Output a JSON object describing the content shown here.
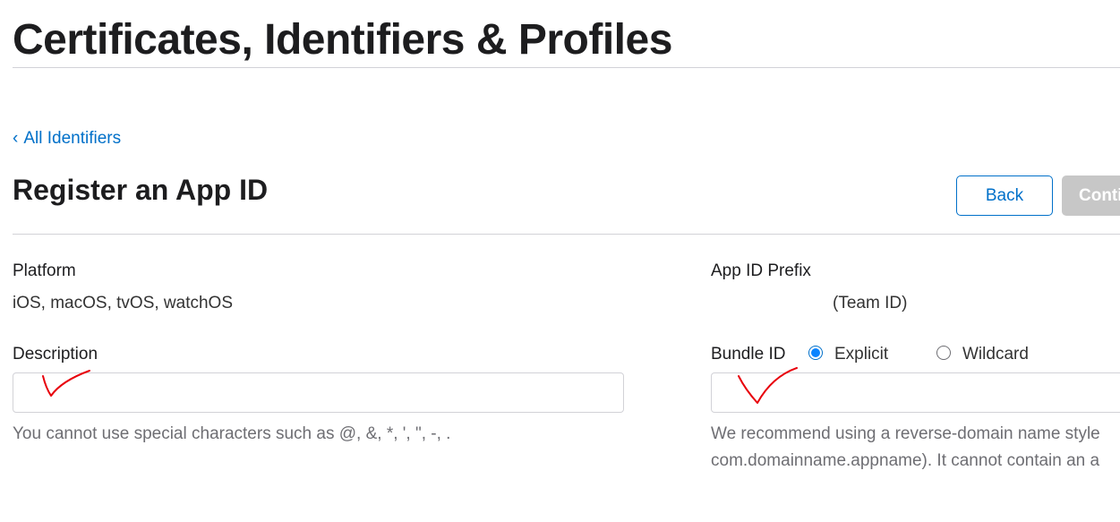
{
  "header": {
    "title": "Certificates, Identifiers & Profiles"
  },
  "nav": {
    "back_link_chevron": "‹",
    "back_link_label": "All Identifiers"
  },
  "form": {
    "title": "Register an App ID",
    "back_button": "Back",
    "continue_button": "Conti",
    "platform": {
      "label": "Platform",
      "value": "iOS, macOS, tvOS, watchOS"
    },
    "app_id_prefix": {
      "label": "App ID Prefix",
      "value": "(Team ID)"
    },
    "description": {
      "label": "Description",
      "value": "",
      "placeholder": "",
      "hint": "You cannot use special characters such as @, &, *, ', \", -, ."
    },
    "bundle_id": {
      "label": "Bundle ID",
      "options": [
        {
          "label": "Explicit",
          "selected": true
        },
        {
          "label": "Wildcard",
          "selected": false
        }
      ],
      "value": "",
      "placeholder": "",
      "hint_line1": "We recommend using a reverse-domain name style",
      "hint_line2": "com.domainname.appname). It cannot contain an a"
    }
  },
  "colors": {
    "link": "#0070c9",
    "radio_selected": "#0a84ff",
    "disabled_button": "#c7c7c7",
    "annotation_mark": "#e8000b"
  }
}
